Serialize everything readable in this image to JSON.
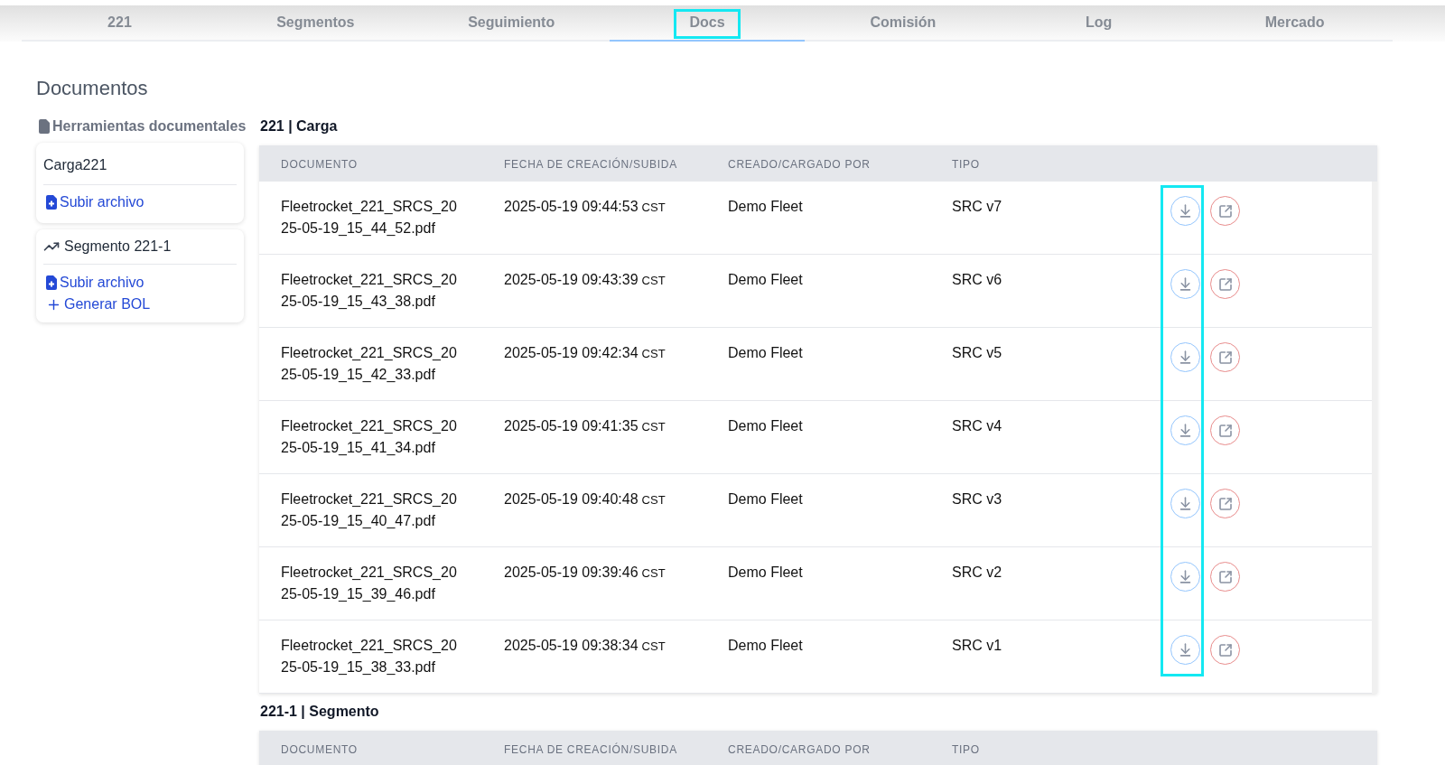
{
  "tabs": [
    {
      "label": "221",
      "selected": false,
      "highlighted": false
    },
    {
      "label": "Segmentos",
      "selected": false,
      "highlighted": false
    },
    {
      "label": "Seguimiento",
      "selected": false,
      "highlighted": false
    },
    {
      "label": "Docs",
      "selected": true,
      "highlighted": true
    },
    {
      "label": "Comisión",
      "selected": false,
      "highlighted": false
    },
    {
      "label": "Log",
      "selected": false,
      "highlighted": false
    },
    {
      "label": "Mercado",
      "selected": false,
      "highlighted": false
    }
  ],
  "page_title": "Documentos",
  "sidebar": {
    "heading": "Herramientas documentales",
    "groups": [
      {
        "kind": "load",
        "title": "Carga221",
        "actions": [
          {
            "kind": "upload",
            "label": "Subir archivo"
          }
        ]
      },
      {
        "kind": "segment",
        "title": "Segmento 221-1",
        "actions": [
          {
            "kind": "upload",
            "label": "Subir archivo"
          },
          {
            "kind": "generate",
            "label": "Generar BOL"
          }
        ]
      }
    ]
  },
  "sections": [
    {
      "title": "221 | Carga",
      "columns": [
        "DOCUMENTO",
        "FECHA DE CREACIÓN/SUBIDA",
        "CREADO/CARGADO POR",
        "TIPO"
      ],
      "highlight_download_column": true,
      "rows": [
        {
          "document": "Fleetrocket_221_SRCS_2025-05-19_15_44_52.pdf",
          "date": "2025-05-19 09:44:53",
          "timezone": "CST",
          "created_by": "Demo Fleet",
          "type": "SRC v7"
        },
        {
          "document": "Fleetrocket_221_SRCS_2025-05-19_15_43_38.pdf",
          "date": "2025-05-19 09:43:39",
          "timezone": "CST",
          "created_by": "Demo Fleet",
          "type": "SRC v6"
        },
        {
          "document": "Fleetrocket_221_SRCS_2025-05-19_15_42_33.pdf",
          "date": "2025-05-19 09:42:34",
          "timezone": "CST",
          "created_by": "Demo Fleet",
          "type": "SRC v5"
        },
        {
          "document": "Fleetrocket_221_SRCS_2025-05-19_15_41_34.pdf",
          "date": "2025-05-19 09:41:35",
          "timezone": "CST",
          "created_by": "Demo Fleet",
          "type": "SRC v4"
        },
        {
          "document": "Fleetrocket_221_SRCS_2025-05-19_15_40_47.pdf",
          "date": "2025-05-19 09:40:48",
          "timezone": "CST",
          "created_by": "Demo Fleet",
          "type": "SRC v3"
        },
        {
          "document": "Fleetrocket_221_SRCS_2025-05-19_15_39_46.pdf",
          "date": "2025-05-19 09:39:46",
          "timezone": "CST",
          "created_by": "Demo Fleet",
          "type": "SRC v2"
        },
        {
          "document": "Fleetrocket_221_SRCS_2025-05-19_15_38_33.pdf",
          "date": "2025-05-19 09:38:34",
          "timezone": "CST",
          "created_by": "Demo Fleet",
          "type": "SRC v1"
        }
      ]
    },
    {
      "title": "221-1 | Segmento",
      "columns": [
        "DOCUMENTO",
        "FECHA DE CREACIÓN/SUBIDA",
        "CREADO/CARGADO POR",
        "TIPO"
      ]
    }
  ]
}
